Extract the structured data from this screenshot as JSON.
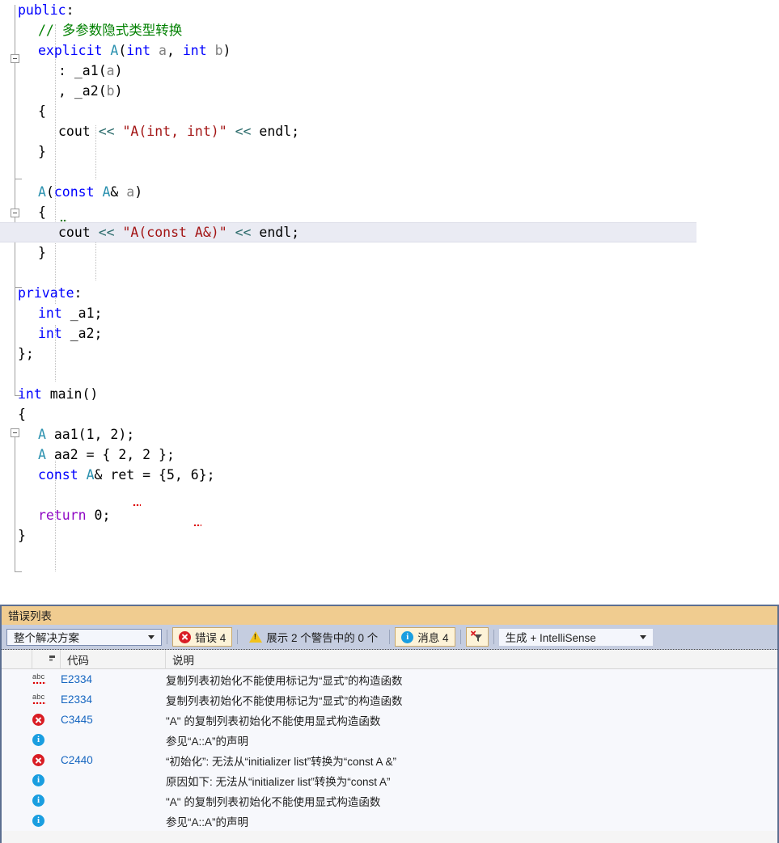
{
  "editor": {
    "lines": [
      {
        "indent": 0,
        "tokens": [
          {
            "t": "public",
            "c": "kw"
          },
          {
            "t": ":",
            "c": "pl"
          }
        ]
      },
      {
        "indent": 1,
        "tokens": [
          {
            "t": "// 多参数隐式类型转换",
            "c": "cmt"
          }
        ]
      },
      {
        "indent": 1,
        "tokens": [
          {
            "t": "explicit",
            "c": "kw"
          },
          {
            "t": " ",
            "c": "pl"
          },
          {
            "t": "A",
            "c": "cls"
          },
          {
            "t": "(",
            "c": "pl"
          },
          {
            "t": "int",
            "c": "kw"
          },
          {
            "t": " ",
            "c": "pl"
          },
          {
            "t": "a",
            "c": "par"
          },
          {
            "t": ", ",
            "c": "pl"
          },
          {
            "t": "int",
            "c": "kw"
          },
          {
            "t": " ",
            "c": "pl"
          },
          {
            "t": "b",
            "c": "par"
          },
          {
            "t": ")",
            "c": "pl"
          }
        ]
      },
      {
        "indent": 2,
        "tokens": [
          {
            "t": ": ",
            "c": "pl"
          },
          {
            "t": "_a1",
            "c": "pl"
          },
          {
            "t": "(",
            "c": "pl"
          },
          {
            "t": "a",
            "c": "par"
          },
          {
            "t": ")",
            "c": "pl"
          }
        ]
      },
      {
        "indent": 2,
        "tokens": [
          {
            "t": ", ",
            "c": "pl"
          },
          {
            "t": "_a2",
            "c": "pl"
          },
          {
            "t": "(",
            "c": "pl"
          },
          {
            "t": "b",
            "c": "par"
          },
          {
            "t": ")",
            "c": "pl"
          }
        ]
      },
      {
        "indent": 1,
        "tokens": [
          {
            "t": "{",
            "c": "pl"
          }
        ]
      },
      {
        "indent": 2,
        "tokens": [
          {
            "t": "cout",
            "c": "pl"
          },
          {
            "t": " ",
            "c": "pl"
          },
          {
            "t": "<<",
            "c": "op"
          },
          {
            "t": " ",
            "c": "pl"
          },
          {
            "t": "\"A(int, int)\"",
            "c": "str"
          },
          {
            "t": " ",
            "c": "pl"
          },
          {
            "t": "<<",
            "c": "op"
          },
          {
            "t": " ",
            "c": "pl"
          },
          {
            "t": "endl",
            "c": "pl"
          },
          {
            "t": ";",
            "c": "pl"
          }
        ]
      },
      {
        "indent": 1,
        "tokens": [
          {
            "t": "}",
            "c": "pl"
          }
        ]
      },
      {
        "indent": 0,
        "tokens": []
      },
      {
        "indent": 1,
        "tokens": [
          {
            "t": "A",
            "c": "cls"
          },
          {
            "t": "(",
            "c": "pl"
          },
          {
            "t": "const",
            "c": "kw"
          },
          {
            "t": " ",
            "c": "pl"
          },
          {
            "t": "A",
            "c": "cls"
          },
          {
            "t": "& ",
            "c": "pl"
          },
          {
            "t": "a",
            "c": "par"
          },
          {
            "t": ")",
            "c": "pl"
          }
        ]
      },
      {
        "indent": 1,
        "tokens": [
          {
            "t": "{",
            "c": "pl"
          }
        ]
      },
      {
        "indent": 2,
        "highlight": true,
        "tokens": [
          {
            "t": "cout",
            "c": "pl"
          },
          {
            "t": " ",
            "c": "pl"
          },
          {
            "t": "<<",
            "c": "op"
          },
          {
            "t": " ",
            "c": "pl"
          },
          {
            "t": "\"A(const A&)\"",
            "c": "str"
          },
          {
            "t": " ",
            "c": "pl"
          },
          {
            "t": "<<",
            "c": "op"
          },
          {
            "t": " ",
            "c": "pl"
          },
          {
            "t": "endl",
            "c": "pl"
          },
          {
            "t": ";",
            "c": "pl"
          }
        ]
      },
      {
        "indent": 1,
        "tokens": [
          {
            "t": "}",
            "c": "pl"
          }
        ]
      },
      {
        "indent": 0,
        "tokens": []
      },
      {
        "indent": 0,
        "tokens": [
          {
            "t": "private",
            "c": "kw"
          },
          {
            "t": ":",
            "c": "pl"
          }
        ]
      },
      {
        "indent": 1,
        "tokens": [
          {
            "t": "int",
            "c": "kw"
          },
          {
            "t": " _a1;",
            "c": "pl"
          }
        ]
      },
      {
        "indent": 1,
        "tokens": [
          {
            "t": "int",
            "c": "kw"
          },
          {
            "t": " _a2;",
            "c": "pl"
          }
        ]
      },
      {
        "indent": 0,
        "tokens": [
          {
            "t": "};",
            "c": "pl"
          }
        ]
      },
      {
        "indent": 0,
        "tokens": []
      },
      {
        "indent": 0,
        "tokens": [
          {
            "t": "int",
            "c": "kw"
          },
          {
            "t": " main()",
            "c": "pl"
          }
        ]
      },
      {
        "indent": 0,
        "tokens": [
          {
            "t": "{",
            "c": "pl"
          }
        ]
      },
      {
        "indent": 1,
        "tokens": [
          {
            "t": "A",
            "c": "cls"
          },
          {
            "t": " aa1(",
            "c": "pl"
          },
          {
            "t": "1",
            "c": "num"
          },
          {
            "t": ", ",
            "c": "pl"
          },
          {
            "t": "2",
            "c": "num"
          },
          {
            "t": ");",
            "c": "pl"
          }
        ]
      },
      {
        "indent": 1,
        "tokens": [
          {
            "t": "A",
            "c": "cls"
          },
          {
            "t": " aa2 = { ",
            "c": "pl"
          },
          {
            "t": "2",
            "c": "num"
          },
          {
            "t": ", ",
            "c": "pl"
          },
          {
            "t": "2",
            "c": "num"
          },
          {
            "t": " };",
            "c": "pl"
          }
        ]
      },
      {
        "indent": 1,
        "tokens": [
          {
            "t": "const",
            "c": "kw"
          },
          {
            "t": " ",
            "c": "pl"
          },
          {
            "t": "A",
            "c": "cls"
          },
          {
            "t": "& ret = {",
            "c": "pl"
          },
          {
            "t": "5",
            "c": "num"
          },
          {
            "t": ", ",
            "c": "pl"
          },
          {
            "t": "6",
            "c": "num"
          },
          {
            "t": "};",
            "c": "pl"
          }
        ]
      },
      {
        "indent": 0,
        "tokens": []
      },
      {
        "indent": 1,
        "tokens": [
          {
            "t": "return",
            "c": "ctl"
          },
          {
            "t": " ",
            "c": "pl"
          },
          {
            "t": "0",
            "c": "num"
          },
          {
            "t": ";",
            "c": "pl"
          }
        ]
      },
      {
        "indent": 0,
        "tokens": [
          {
            "t": "}",
            "c": "pl"
          }
        ]
      }
    ]
  },
  "error_panel": {
    "title": "错误列表",
    "toolbar": {
      "scope_value": "整个解决方案",
      "errors_label": "错误 4",
      "warnings_label": "展示 2 个警告中的 0 个",
      "messages_label": "消息 4",
      "clear_filter_name": "clear-filter",
      "build_filter_value": "生成 + IntelliSense"
    },
    "columns": [
      "",
      "代码",
      "说明"
    ],
    "rows": [
      {
        "icon": "intellisense-error",
        "code": "E2334",
        "desc": "复制列表初始化不能使用标记为“显式”的构造函数"
      },
      {
        "icon": "intellisense-error",
        "code": "E2334",
        "desc": "复制列表初始化不能使用标记为“显式”的构造函数"
      },
      {
        "icon": "error",
        "code": "C3445",
        "desc": "\"A\" 的复制列表初始化不能使用显式构造函数"
      },
      {
        "icon": "info",
        "code": "",
        "desc": "参见“A::A”的声明"
      },
      {
        "icon": "error",
        "code": "C2440",
        "desc": "“初始化”: 无法从“initializer list”转换为“const A &”"
      },
      {
        "icon": "info",
        "code": "",
        "desc": "原因如下: 无法从“initializer list”转换为“const A”"
      },
      {
        "icon": "info",
        "code": "",
        "desc": "\"A\" 的复制列表初始化不能使用显式构造函数"
      },
      {
        "icon": "info",
        "code": "",
        "desc": "参见“A::A”的声明"
      }
    ]
  },
  "colors": {
    "keyword": "#0000ff",
    "class": "#2b91af",
    "string": "#a31515",
    "comment": "#008000",
    "parameter": "#808080",
    "operator": "#2b6b6b",
    "control": "#8f08c4",
    "panel_title_bg": "#f0cc90",
    "panel_border": "#5c6f91",
    "toolbar_bg": "#c5cde0",
    "row_bg": "#f7f8fc",
    "code_link": "#1666c0",
    "error_red": "#d91d24",
    "info_blue": "#1a9ee0",
    "warn_yellow": "#f2c21b",
    "highlight_line_bg": "#eaebf3"
  }
}
